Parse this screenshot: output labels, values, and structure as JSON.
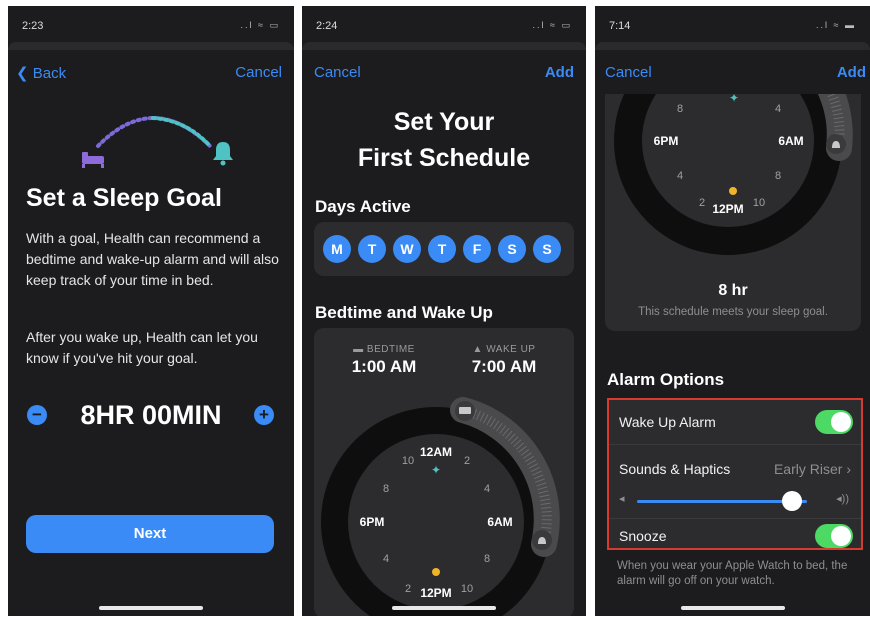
{
  "colors": {
    "accent": "#3a8bf5",
    "background": "#1c1c1e",
    "card": "#2c2c2e",
    "toggle_on": "#4cd964",
    "highlight": "#d73a2f",
    "moon": "#8d6bd8",
    "sun": "#f0b429",
    "bell": "#4fc3c3"
  },
  "screen1": {
    "time": "2:23",
    "signal": "..l ≈ ▭",
    "nav_left": "Back",
    "nav_right": "Cancel",
    "title": "Set a Sleep Goal",
    "paragraph1": "With a goal, Health can recommend a bedtime and wake-up alarm and will also keep track of your time in bed.",
    "paragraph2": "After you wake up, Health can let you know if you've hit your goal.",
    "goal_value": "8HR 00MIN",
    "minus_label": "−",
    "plus_label": "+",
    "next_label": "Next",
    "icons": {
      "bed": "bed-icon",
      "bell": "bell-icon"
    }
  },
  "screen2": {
    "time": "2:24",
    "signal": "..l ≈ ▭",
    "nav_left": "Cancel",
    "nav_right": "Add",
    "title_line1": "Set Your",
    "title_line2": "First Schedule",
    "days_heading": "Days Active",
    "days": [
      "M",
      "T",
      "W",
      "T",
      "F",
      "S",
      "S"
    ],
    "schedule_heading": "Bedtime and Wake Up",
    "bedtime_label": "BEDTIME",
    "bedtime_value": "1:00 AM",
    "wakeup_label": "WAKE UP",
    "wakeup_value": "7:00 AM",
    "clock_labels": {
      "top": "12AM",
      "bottom": "12PM",
      "left": "6PM",
      "right": "6AM",
      "n10t": "10",
      "n2t": "2",
      "n8l": "8",
      "n4r": "4",
      "n4l": "4",
      "n8r": "8",
      "n2b": "2",
      "n10b": "10"
    }
  },
  "screen3": {
    "time": "7:14",
    "signal": "..l ≈ ▬",
    "nav_left": "Cancel",
    "nav_right": "Add",
    "clock_labels": {
      "bottom": "12PM",
      "left": "6PM",
      "right": "6AM",
      "n8l": "8",
      "n4r": "4",
      "n4l": "4",
      "n8r": "8",
      "n2b": "2",
      "n10b": "10"
    },
    "duration": "8 hr",
    "meets_goal": "This schedule meets your sleep goal.",
    "alarm_heading": "Alarm Options",
    "wake_alarm_label": "Wake Up Alarm",
    "wake_alarm_on": true,
    "sounds_label": "Sounds & Haptics",
    "sounds_value": "Early Riser",
    "volume_level": 0.91,
    "snooze_label": "Snooze",
    "snooze_on": true,
    "footnote": "When you wear your Apple Watch to bed, the alarm will go off on your watch."
  }
}
